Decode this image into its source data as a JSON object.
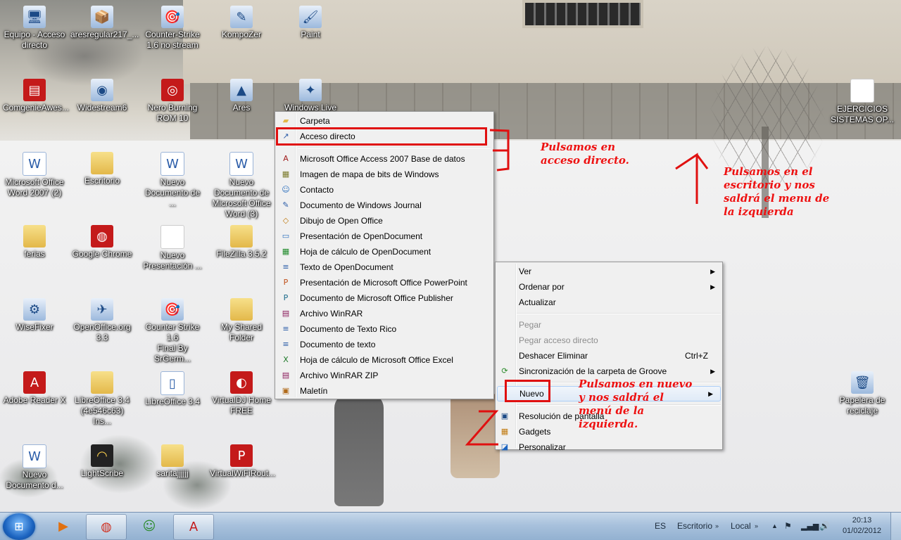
{
  "desktop": {
    "icons": [
      {
        "label": "Equipo - Acceso\ndirecto",
        "icon": "computer-icon",
        "glyph": "🖥",
        "style": "g-app",
        "name": "computer-shortcut"
      },
      {
        "label": "aresregular217_...",
        "icon": "installer-icon",
        "glyph": "📦",
        "style": "g-app",
        "name": "ares-installer"
      },
      {
        "label": "Counter-Strike\n1.6 no stream",
        "icon": "counter-strike-icon",
        "glyph": "🎯",
        "style": "g-app",
        "name": "counter-strike"
      },
      {
        "label": "KompoZer",
        "icon": "kompozer-icon",
        "glyph": "✎",
        "style": "g-app",
        "name": "kompozer"
      },
      {
        "label": "Paint",
        "icon": "paint-icon",
        "glyph": "🖌",
        "style": "g-app",
        "name": "paint"
      },
      {
        "label": "ComgenieAwes...",
        "icon": "winrar-icon",
        "glyph": "▤",
        "style": "g-red",
        "name": "comgenie"
      },
      {
        "label": "Widestream6",
        "icon": "widestream-icon",
        "glyph": "◉",
        "style": "g-app",
        "name": "widestream"
      },
      {
        "label": "Nero Burning\nROM 10",
        "icon": "nero-icon",
        "glyph": "◎",
        "style": "g-red",
        "name": "nero"
      },
      {
        "label": "Ares",
        "icon": "ares-icon",
        "glyph": "▲",
        "style": "g-app",
        "name": "ares"
      },
      {
        "label": "Windows Live",
        "icon": "windows-live-icon",
        "glyph": "✦",
        "style": "g-app",
        "name": "windows-live"
      },
      {
        "label": "Microsoft Office\nWord 2007 (2)",
        "icon": "word-icon",
        "glyph": "W",
        "style": "g-doc",
        "name": "word-2007"
      },
      {
        "label": "Escritorio",
        "icon": "folder-icon",
        "glyph": "",
        "style": "g-folder",
        "name": "folder-escritorio"
      },
      {
        "label": "Nuevo\nDocumento de ...",
        "icon": "word-doc-icon",
        "glyph": "W",
        "style": "g-doc",
        "name": "nuevo-documento-1"
      },
      {
        "label": "Nuevo\nDocumento de\nMicrosoft Office\nWord (3)",
        "icon": "word-doc-icon",
        "glyph": "W",
        "style": "g-doc",
        "name": "nuevo-documento-word-3"
      },
      {
        "label": "ferias",
        "icon": "folder-icon",
        "glyph": "",
        "style": "g-folder",
        "name": "folder-ferias"
      },
      {
        "label": "Google Chrome",
        "icon": "chrome-icon",
        "glyph": "◍",
        "style": "g-red",
        "name": "google-chrome"
      },
      {
        "label": "Nuevo\nPresentación ...",
        "icon": "blank-file-icon",
        "glyph": "",
        "style": "g-blank",
        "name": "nueva-presentacion"
      },
      {
        "label": "FileZilla 3.5.2",
        "icon": "folder-icon",
        "glyph": "",
        "style": "g-folder",
        "name": "filezilla"
      },
      {
        "label": "WiseFixer",
        "icon": "wisefixer-icon",
        "glyph": "⚙",
        "style": "g-app",
        "name": "wisefixer"
      },
      {
        "label": "OpenOffice.org\n3.3",
        "icon": "openoffice-icon",
        "glyph": "✈",
        "style": "g-app",
        "name": "openoffice"
      },
      {
        "label": "Counter Strike 1.6\nFinal By SrGerm...",
        "icon": "counter-strike-icon",
        "glyph": "🎯",
        "style": "g-app",
        "name": "counter-strike-final"
      },
      {
        "label": "My Shared Folder",
        "icon": "folder-icon",
        "glyph": "",
        "style": "g-folder",
        "name": "my-shared-folder"
      },
      {
        "label": "Adobe Reader X",
        "icon": "adobe-reader-icon",
        "glyph": "A",
        "style": "g-red",
        "name": "adobe-reader"
      },
      {
        "label": "LibreOffice 3.4\n(4e546c63) Ins...",
        "icon": "folder-icon",
        "glyph": "",
        "style": "g-folder",
        "name": "libreoffice-installer"
      },
      {
        "label": "LibreOffice 3.4",
        "icon": "libreoffice-icon",
        "glyph": "▯",
        "style": "g-doc",
        "name": "libreoffice"
      },
      {
        "label": "VirtualDJ Home\nFREE",
        "icon": "virtualdj-icon",
        "glyph": "◐",
        "style": "g-red",
        "name": "virtualdj"
      },
      {
        "label": "Nuevo\nDocumento d...",
        "icon": "word-doc-icon",
        "glyph": "W",
        "style": "g-doc",
        "name": "nuevo-documento-2"
      },
      {
        "label": "LightScribe",
        "icon": "lightscribe-icon",
        "glyph": "◠",
        "style": "g-dark",
        "name": "lightscribe"
      },
      {
        "label": "saritajjjjjj",
        "icon": "folder-icon",
        "glyph": "",
        "style": "g-folder",
        "name": "folder-saritajjjjjj"
      },
      {
        "label": "VirtualWiFiRout...",
        "icon": "virtualwifi-icon",
        "glyph": "P",
        "style": "g-red",
        "name": "virtualwifi"
      },
      {
        "label": "EJERCICIOS\nSISTEMAS OP...",
        "icon": "document-icon",
        "glyph": "",
        "style": "g-blank",
        "name": "ejercicios-sistemas"
      },
      {
        "label": "Papelera de\nreciclaje",
        "icon": "recycle-bin-icon",
        "glyph": "🗑",
        "style": "g-app",
        "name": "recycle-bin"
      }
    ]
  },
  "new_submenu": {
    "items": [
      {
        "label": "Carpeta",
        "icon": "folder-icon",
        "glyph": "▰",
        "color": "#e3b84a"
      },
      {
        "label": "Acceso directo",
        "icon": "shortcut-icon",
        "glyph": "↗",
        "color": "#2a5ca8"
      },
      {
        "label": "Microsoft Office Access 2007 Base de datos",
        "icon": "access-icon",
        "glyph": "A",
        "color": "#a01c1c"
      },
      {
        "label": "Imagen de mapa de bits de Windows",
        "icon": "bitmap-icon",
        "glyph": "▦",
        "color": "#7a7a2a"
      },
      {
        "label": "Contacto",
        "icon": "contact-icon",
        "glyph": "☺",
        "color": "#2a6ebd"
      },
      {
        "label": "Documento de Windows Journal",
        "icon": "journal-icon",
        "glyph": "✎",
        "color": "#2a5ca8"
      },
      {
        "label": "Dibujo de Open Office",
        "icon": "draw-icon",
        "glyph": "◇",
        "color": "#c07a10"
      },
      {
        "label": "Presentación de OpenDocument",
        "icon": "odp-icon",
        "glyph": "▭",
        "color": "#2a6ebd"
      },
      {
        "label": "Hoja de cálculo de OpenDocument",
        "icon": "ods-icon",
        "glyph": "▦",
        "color": "#1f8a2a"
      },
      {
        "label": "Texto de OpenDocument",
        "icon": "odt-icon",
        "glyph": "≡",
        "color": "#2a5ca8"
      },
      {
        "label": "Presentación de Microsoft Office PowerPoint",
        "icon": "powerpoint-icon",
        "glyph": "P",
        "color": "#c0501a"
      },
      {
        "label": "Documento de Microsoft Office Publisher",
        "icon": "publisher-icon",
        "glyph": "P",
        "color": "#1a6a8a"
      },
      {
        "label": "Archivo WinRAR",
        "icon": "winrar-icon",
        "glyph": "▤",
        "color": "#8a1a5a"
      },
      {
        "label": "Documento de Texto Rico",
        "icon": "rtf-icon",
        "glyph": "≡",
        "color": "#2a5ca8"
      },
      {
        "label": "Documento de texto",
        "icon": "text-file-icon",
        "glyph": "≡",
        "color": "#2a5ca8"
      },
      {
        "label": "Hoja de cálculo de Microsoft Office Excel",
        "icon": "excel-icon",
        "glyph": "X",
        "color": "#1f7a2a"
      },
      {
        "label": "Archivo WinRAR ZIP",
        "icon": "winrar-zip-icon",
        "glyph": "▤",
        "color": "#8a1a5a"
      },
      {
        "label": "Maletín",
        "icon": "briefcase-icon",
        "glyph": "▣",
        "color": "#b06a1a"
      }
    ]
  },
  "desktop_menu": {
    "ver": "Ver",
    "ordenar": "Ordenar por",
    "actualizar": "Actualizar",
    "pegar": "Pegar",
    "pegar_acceso": "Pegar acceso directo",
    "deshacer": "Deshacer Eliminar",
    "deshacer_shortcut": "Ctrl+Z",
    "groove": "Sincronización de la carpeta de Groove",
    "nuevo": "Nuevo",
    "resolucion": "Resolución de pantalla",
    "gadgets": "Gadgets",
    "personalizar": "Personalizar"
  },
  "annotations": {
    "acceso": "Pulsamos en\nacceso directo.",
    "escritorio": "Pulsamos en el\nescritorio y nos\nsaldrá el menu de\nla izquierda",
    "nuevo": "Pulsamos en nuevo\ny nos saldrá el\nmenú de la\nizquierda.",
    "accent": "#ee1111"
  },
  "taskbar": {
    "language": "ES",
    "toolbar_escritorio": "Escritorio",
    "toolbar_local": "Local",
    "time": "20:13",
    "date": "01/02/2012"
  }
}
